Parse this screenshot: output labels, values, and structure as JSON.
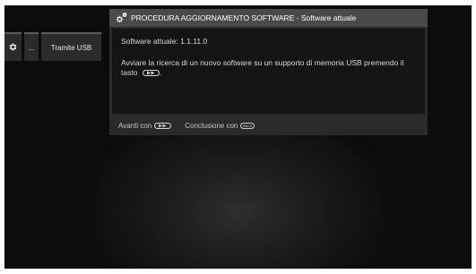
{
  "menu": {
    "items": [
      {
        "icon": "gear-icon"
      },
      {
        "label": "..."
      },
      {
        "label": "Tramite USB"
      }
    ]
  },
  "dialog": {
    "title": "PROCEDURA AGGIORNAMENTO SOFTWARE - Software attuale",
    "title_icon": "gears-icon",
    "version_line": "Software attuale: 1.1.11.0",
    "instruction_text": "Avviare la ricerca di un nuovo software su un supporto di memoria USB premendo il tasto",
    "instruction_key_icon": "fast-forward-key-icon",
    "instruction_end": ".",
    "footer": {
      "next_label": "Avanti con",
      "next_key_icon": "fast-forward-key-icon",
      "close_label": "Conclusione con",
      "close_key_icon": "back-key-icon",
      "close_key_text": "BACK"
    }
  },
  "colors": {
    "screen_background": "#0c0c0c",
    "dialog_header": "#4a4a4c",
    "dialog_body": "#141416",
    "text": "#d8d8d8"
  }
}
